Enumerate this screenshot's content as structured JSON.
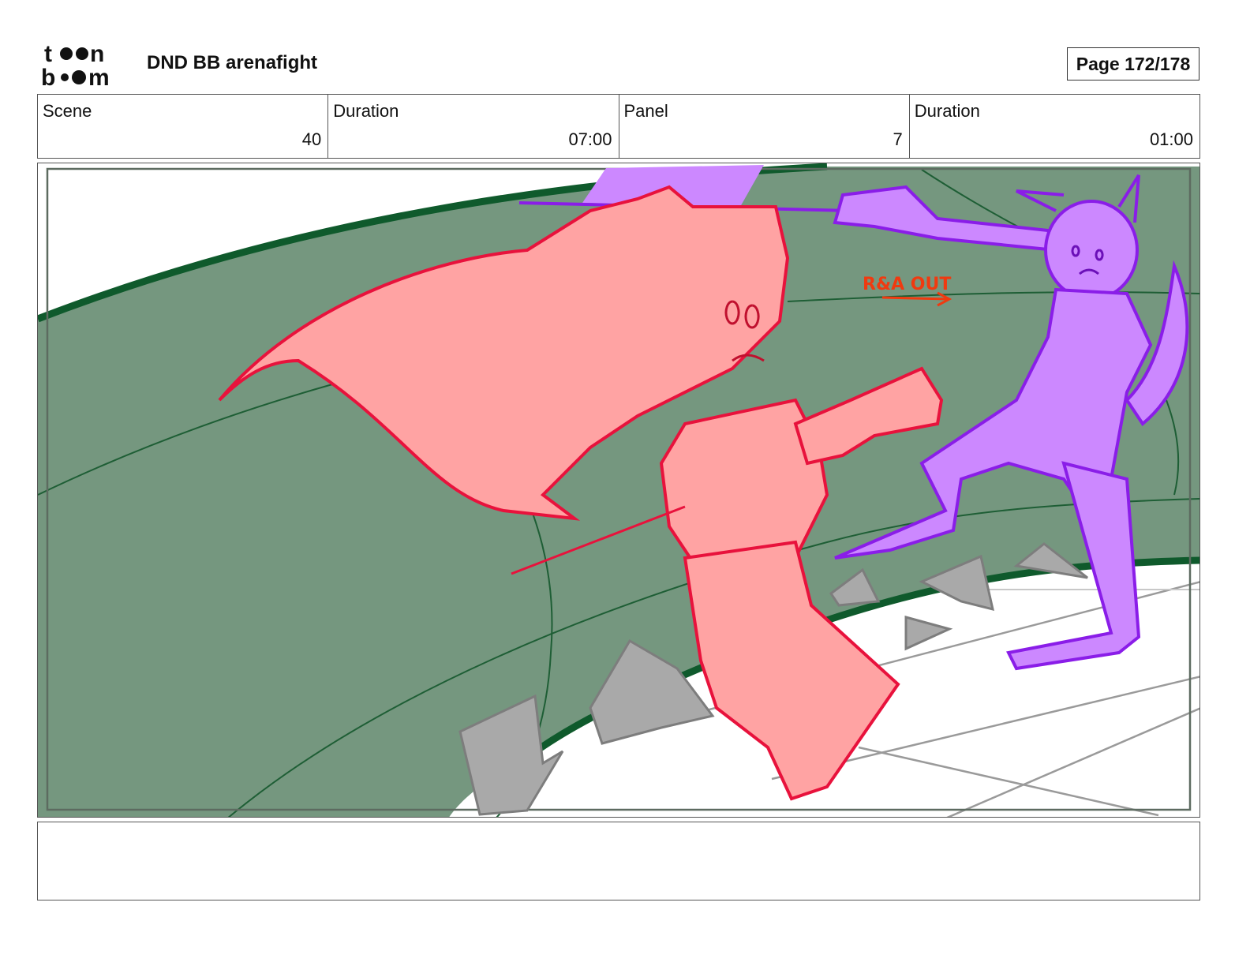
{
  "header": {
    "logo_top": "t●●n",
    "logo_bottom": "b●●m",
    "project_title": "DND BB arenafight",
    "page_label": "Page 172/178"
  },
  "info": [
    {
      "label": "Scene",
      "value": "40"
    },
    {
      "label": "Duration",
      "value": "07:00"
    },
    {
      "label": "Panel",
      "value": "7"
    },
    {
      "label": "Duration",
      "value": "01:00"
    }
  ],
  "panel": {
    "annotation": "R&A OUT",
    "colors": {
      "arena_wall": "#75977f",
      "arena_rim": "#0f5a2c",
      "hero_fill": "#ffa3a3",
      "hero_line": "#e8123c",
      "foe_fill": "#cc88ff",
      "foe_line": "#8a1de8",
      "rubble": "#a9a9a9",
      "annotation": "#f03a10"
    }
  },
  "notes": {
    "text": ""
  }
}
